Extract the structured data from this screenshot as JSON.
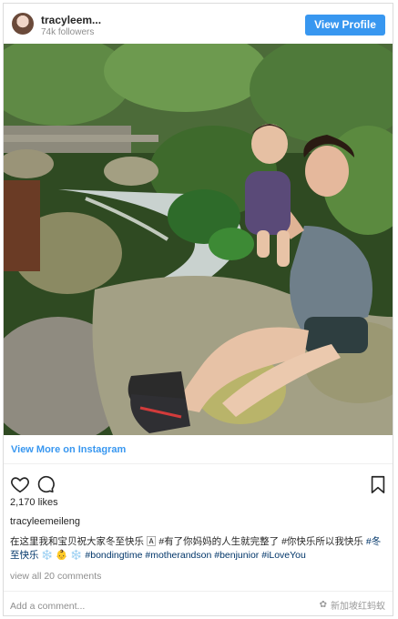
{
  "header": {
    "username": "tracyleem...",
    "followers": "74k followers",
    "view_profile_label": "View Profile"
  },
  "photo": {
    "alt_icon": "photo-of-woman-and-baby-by-stream"
  },
  "view_more_label": "View More on Instagram",
  "actions": {
    "like_icon": "heart-icon",
    "comment_icon": "comment-icon",
    "save_icon": "bookmark-icon"
  },
  "likes": "2,170 likes",
  "caption": {
    "username": "tracyleemeileng",
    "text": "在这里我和宝贝祝大家冬至快乐 🄰 #有了你妈妈的人生就完整了 #你快乐所以我快乐",
    "tags": "#冬至快乐 ❄️ 👶 ❄️ #bondingtime #motherandson #benjunior #iLoveYou"
  },
  "view_all_comments": "view all 20 comments",
  "add_comment_placeholder": "Add a comment...",
  "watermark": "新加坡红蚂蚁",
  "colors": {
    "accent": "#3897f0",
    "tag": "#003569",
    "muted": "#8e8e8e"
  }
}
